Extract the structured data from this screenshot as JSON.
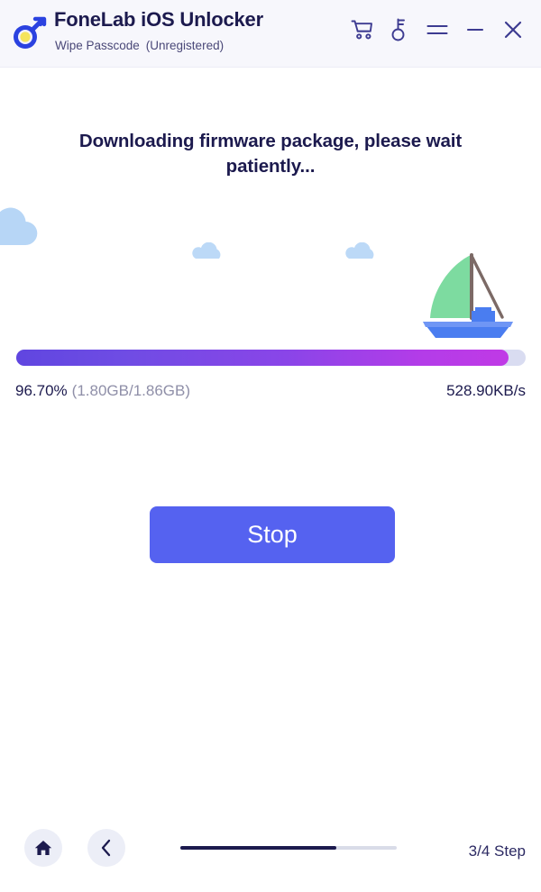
{
  "window": {
    "title": "FoneLab iOS Unlocker",
    "subtitle_mode": "Wipe Passcode",
    "subtitle_license": "(Unregistered)",
    "titlebar_bg": "#f7f7fc",
    "brand_color": "#1c1a4e",
    "accent_color": "#5562f0"
  },
  "titlebar_icons": [
    {
      "name": "cart-icon",
      "label": "Cart"
    },
    {
      "name": "key-icon",
      "label": "Register"
    },
    {
      "name": "menu-icon",
      "label": "Menu"
    },
    {
      "name": "minimize-icon",
      "label": "Minimize"
    },
    {
      "name": "close-icon",
      "label": "Close"
    }
  ],
  "main": {
    "headline": "Downloading firmware package, please wait patiently...",
    "illustration": {
      "boat_sail_color": "#7ddba0",
      "boat_hull_color": "#4a7df0",
      "boat_mast_color": "#7c6a66",
      "cloud_color": "#b9d8f7"
    },
    "progress": {
      "percent_value": 96.7,
      "percent_label": "96.70%",
      "sizes_label": "(1.80GB/1.86GB)",
      "speed_label": "528.90KB/s",
      "downloaded_gb": 1.8,
      "total_gb": 1.86,
      "speed_kbps": 528.9,
      "fill_start_color": "#6046e0",
      "fill_end_color": "#c03ae6",
      "track_color": "#d9dcf1"
    },
    "stop_button": "Stop"
  },
  "footer": {
    "home_icon": "home-icon",
    "back_icon": "chevron-left-icon",
    "step_label": "3/4 Step",
    "step_current": 3,
    "step_total": 4,
    "step_percent": 72,
    "step_fill_color": "#1c1a4e",
    "step_track_color": "#d9dce8"
  }
}
